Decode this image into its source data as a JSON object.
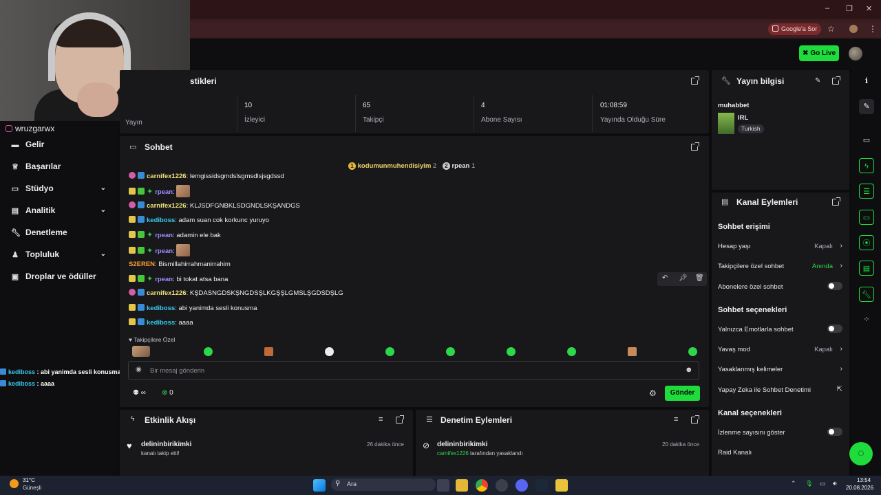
{
  "browser": {
    "google_pill": "Google'a Sor",
    "window_buttons": [
      "–",
      "❐",
      "✕"
    ]
  },
  "topbar": {
    "go_live": "Go Live"
  },
  "webcam": {
    "instagram_handle": "wruzgarwx"
  },
  "sidebar": {
    "items": [
      {
        "label": "Gelir",
        "icon": "wallet-icon"
      },
      {
        "label": "Başarılar",
        "icon": "trophy-icon"
      },
      {
        "label": "Stüdyo",
        "icon": "studio-icon",
        "chevron": true
      },
      {
        "label": "Analitik",
        "icon": "analytics-icon",
        "chevron": true
      },
      {
        "label": "Denetleme",
        "icon": "wrench-icon"
      },
      {
        "label": "Topluluk",
        "icon": "community-icon",
        "chevron": true
      },
      {
        "label": "Droplar ve ödüller",
        "icon": "gift-icon"
      }
    ],
    "overlay_chat": [
      {
        "user": "kediboss",
        "text": " : abi yanimda sesli konusma"
      },
      {
        "user": "kediboss",
        "text": " : aaaa"
      }
    ]
  },
  "stats": {
    "title": "stikleri",
    "items": [
      {
        "value": "",
        "label": "Yayın"
      },
      {
        "value": "10",
        "label": "İzleyici"
      },
      {
        "value": "65",
        "label": "Takipçi"
      },
      {
        "value": "4",
        "label": "Abone Sayısı"
      },
      {
        "value": "01:08:59",
        "label": "Yayında Olduğu Süre"
      }
    ]
  },
  "chat": {
    "title": "Sohbet",
    "leaderboard": [
      {
        "rank": "1",
        "user": "kodumunmuhendisiyim",
        "count": "2"
      },
      {
        "rank": "2",
        "user": "rpean",
        "count": "1"
      }
    ],
    "messages": [
      {
        "user": "carnifex1226",
        "text": "lemgissidsgmdslsgmsdlsjsgdssd",
        "color": "u-yellow",
        "badges": [
          "pink",
          "blue"
        ]
      },
      {
        "user": "rpean",
        "text": "",
        "color": "u-violet",
        "badges": [
          "yellow",
          "green",
          "star"
        ],
        "emote": true
      },
      {
        "user": "carnifex1226",
        "text": "KLJSDFGNBKLSDGNDLSKŞANDGS",
        "color": "u-yellow",
        "badges": [
          "pink",
          "blue"
        ]
      },
      {
        "user": "kediboss",
        "text": "adam suan cok korkunc yuruyo",
        "color": "u-cyan",
        "badges": [
          "yellow",
          "blue"
        ]
      },
      {
        "user": "rpean",
        "text": "adamin ele bak",
        "color": "u-violet",
        "badges": [
          "yellow",
          "green",
          "star"
        ]
      },
      {
        "user": "rpean",
        "text": "",
        "color": "u-violet",
        "badges": [
          "yellow",
          "green",
          "star"
        ],
        "emote": true
      },
      {
        "user": "S2EREN",
        "text": "Bismillahirrahmanirrahim",
        "color": "u-orange",
        "badges": []
      },
      {
        "user": "rpean",
        "text": "bi tokat atsa bana",
        "color": "u-violet",
        "badges": [
          "yellow",
          "green",
          "star"
        ]
      },
      {
        "user": "carnifex1226",
        "text": "KŞDASNGDSKŞNGDSŞLKGŞŞLGMSLŞGDSDŞLG",
        "color": "u-yellow",
        "badges": [
          "pink",
          "blue"
        ]
      },
      {
        "user": "kediboss",
        "text": "abi yanimda sesli konusma",
        "color": "u-cyan",
        "badges": [
          "yellow",
          "blue"
        ]
      },
      {
        "user": "kediboss",
        "text": "aaaa",
        "color": "u-cyan",
        "badges": [
          "yellow",
          "blue"
        ]
      }
    ],
    "followers_only_label": "Takipçilere Özel",
    "input_placeholder": "Bir mesaj gönderin",
    "infinity": "∞",
    "points": "0",
    "send": "Gönder"
  },
  "stream_info": {
    "title": "Yayın bilgisi",
    "stream_title": "muhabbet",
    "category": "IRL",
    "language_tag": "Turkish"
  },
  "channel_actions": {
    "title": "Kanal Eylemleri",
    "chat_access_header": "Sohbet erişimi",
    "chat_access": [
      {
        "label": "Hesap yaşı",
        "value": "Kapalı",
        "type": "chevron"
      },
      {
        "label": "Takipçilere özel sohbet",
        "value": "Anında",
        "type": "chevron",
        "accent": "#2bd94a"
      },
      {
        "label": "Abonelere özel sohbet",
        "value": "",
        "type": "toggle"
      }
    ],
    "chat_options_header": "Sohbet seçenekleri",
    "chat_options": [
      {
        "label": "Yalnızca Emotlarla sohbet",
        "value": "",
        "type": "toggle"
      },
      {
        "label": "Yavaş mod",
        "value": "Kapalı",
        "type": "chevron"
      },
      {
        "label": "Yasaklanmış kelimeler",
        "value": "",
        "type": "chevron"
      },
      {
        "label": "Yapay Zeka ile Sohbet Denetimi",
        "value": "",
        "type": "external"
      }
    ],
    "channel_options_header": "Kanal seçenekleri",
    "channel_options": [
      {
        "label": "İzlenme sayısını göster",
        "value": "",
        "type": "toggle"
      },
      {
        "label": "Raid Kanalı",
        "value": "",
        "type": "none"
      }
    ]
  },
  "activity_feed": {
    "title": "Etkinlik Akışı",
    "items": [
      {
        "user": "delininbirikimki",
        "text": "kanalı takip etti!",
        "time": "26 dakika önce"
      }
    ]
  },
  "mod_actions": {
    "title": "Denetim Eylemleri",
    "items": [
      {
        "user": "delininbirikimki",
        "actor": "carnifex1226",
        "text": " tarafından yasaklandı",
        "time": "20 dakika önce"
      }
    ]
  },
  "taskbar": {
    "weather_temp": "31°C",
    "weather_desc": "Güneşli",
    "search": "Ara",
    "time": "13:54",
    "date": "20.08.2026"
  },
  "colors": {
    "accent": "#1fdc3d",
    "panel": "#18181b",
    "background": "#0c0c0e"
  }
}
